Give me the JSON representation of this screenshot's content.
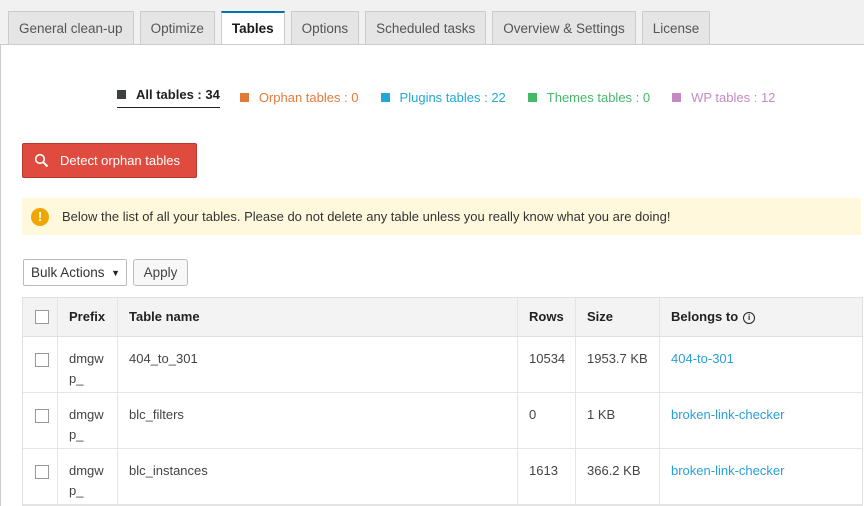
{
  "tabs": [
    {
      "label": "General clean-up"
    },
    {
      "label": "Optimize"
    },
    {
      "label": "Tables"
    },
    {
      "label": "Options"
    },
    {
      "label": "Scheduled tasks"
    },
    {
      "label": "Overview & Settings"
    },
    {
      "label": "License"
    }
  ],
  "active_tab": "Tables",
  "filters": {
    "all": "All tables : 34",
    "orphan": "Orphan tables : 0",
    "plugins": "Plugins tables : 22",
    "themes": "Themes tables : 0",
    "wp": "WP tables : 12"
  },
  "colors": {
    "all": "#3c3f44",
    "orphan": "#e07b39",
    "plugins": "#22a8d6",
    "themes": "#45b86a",
    "wp": "#c58ac3",
    "detect_button": "#df4c3f",
    "notice_bg": "#fff8dc",
    "link": "#2a9fd6"
  },
  "detect_button": {
    "label": "Detect orphan tables",
    "icon": "search-icon"
  },
  "notice": {
    "icon": "warning-icon",
    "text": "Below the list of all your tables. Please do not delete any table unless you really know what you are doing!"
  },
  "bulk": {
    "selected": "Bulk Actions",
    "apply": "Apply"
  },
  "table": {
    "headers": {
      "prefix": "Prefix",
      "name": "Table name",
      "rows": "Rows",
      "size": "Size",
      "belongs": "Belongs to"
    },
    "rows": [
      {
        "prefix_1": "dmgw",
        "prefix_2": "p_",
        "name": "404_to_301",
        "rows": "10534",
        "size": "1953.7 KB",
        "belongs": "404-to-301"
      },
      {
        "prefix_1": "dmgw",
        "prefix_2": "p_",
        "name": "blc_filters",
        "rows": "0",
        "size": "1 KB",
        "belongs": "broken-link-checker"
      },
      {
        "prefix_1": "dmgw",
        "prefix_2": "p_",
        "name": "blc_instances",
        "rows": "1613",
        "size": "366.2 KB",
        "belongs": "broken-link-checker"
      }
    ]
  }
}
